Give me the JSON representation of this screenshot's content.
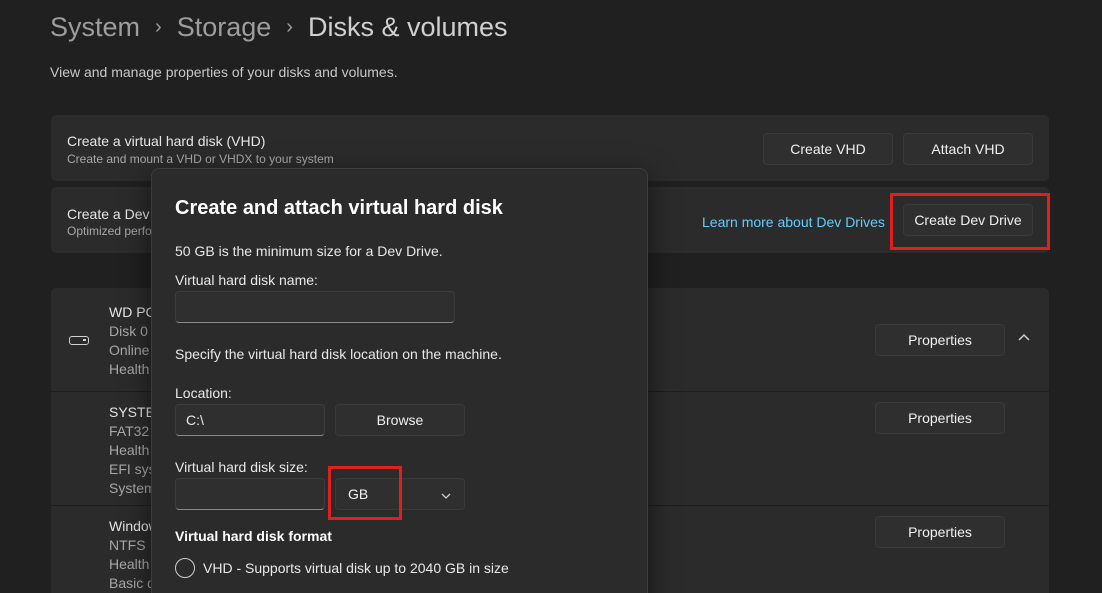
{
  "breadcrumb": {
    "items": [
      "System",
      "Storage",
      "Disks & volumes"
    ],
    "separator": "›"
  },
  "subtitle": "View and manage properties of your disks and volumes.",
  "vhd_card": {
    "title": "Create a virtual hard disk (VHD)",
    "description": "Create and mount a VHD or VHDX to your system",
    "create_button": "Create VHD",
    "attach_button": "Attach VHD"
  },
  "devdrive_card": {
    "title": "Create a Dev",
    "description": "Optimized perfo",
    "learn_more_link": "Learn more about Dev Drives",
    "create_button": "Create Dev Drive"
  },
  "disks": [
    {
      "lines": [
        "WD PC",
        "Disk 0",
        "Online",
        "Health"
      ],
      "properties_button": "Properties"
    },
    {
      "lines": [
        "SYSTEM",
        "FAT32",
        "Health",
        "EFI syst",
        "System"
      ],
      "properties_button": "Properties"
    },
    {
      "lines": [
        "Window",
        "NTFS",
        "Health",
        "Basic d"
      ],
      "properties_button": "Properties"
    }
  ],
  "dialog": {
    "title": "Create and attach virtual hard disk",
    "min_size_note": "50 GB is the minimum size for a Dev Drive.",
    "name_label": "Virtual hard disk name:",
    "name_value": "",
    "location_hint": "Specify the virtual hard disk location on the machine.",
    "location_label": "Location:",
    "location_value": "C:\\",
    "browse_button": "Browse",
    "size_label": "Virtual hard disk size:",
    "size_value": "",
    "size_unit": "GB",
    "format_label": "Virtual hard disk format",
    "format_option_vhd": "VHD - Supports virtual disk up to 2040 GB in size"
  },
  "colors": {
    "background": "#202020",
    "card": "#2b2b2b",
    "accent_link": "#60cdff",
    "highlight": "#e0201c"
  }
}
